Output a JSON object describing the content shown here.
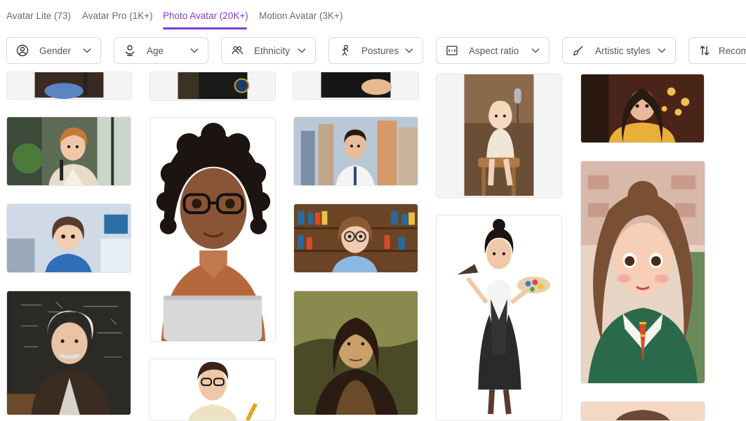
{
  "tabs": [
    {
      "label": "Avatar Lite (73)",
      "active": false
    },
    {
      "label": "Avatar Pro (1K+)",
      "active": false
    },
    {
      "label": "Photo Avatar (20K+)",
      "active": true
    },
    {
      "label": "Motion Avatar (3K+)",
      "active": false
    }
  ],
  "filters": {
    "gender": "Gender",
    "age": "Age",
    "ethnicity": "Ethnicity",
    "postures": "Postures",
    "aspect_ratio": "Aspect ratio",
    "artistic_styles": "Artistic styles",
    "sort": "Recom"
  },
  "colors": {
    "accent": "#7b3fd6",
    "border": "#d9d9d9"
  },
  "icons": [
    "user-circle-icon",
    "child-icon",
    "users-icon",
    "posture-icon",
    "aspect-ratio-icon",
    "brush-icon",
    "sort-icon",
    "chevron-down-icon"
  ]
}
